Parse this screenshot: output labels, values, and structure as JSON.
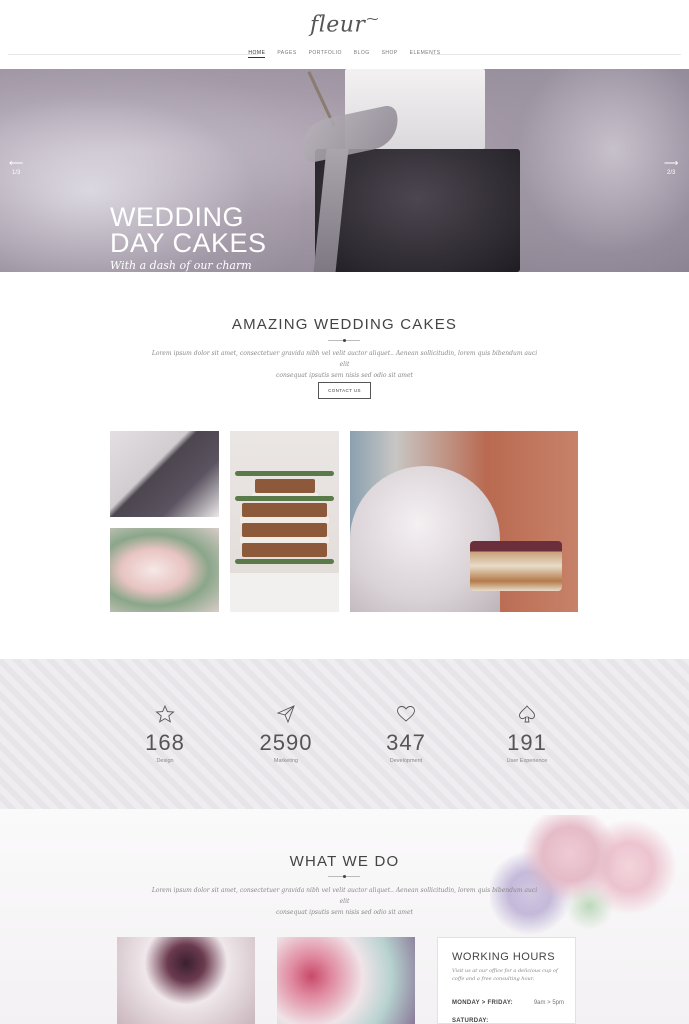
{
  "header": {
    "logo": "fleur",
    "nav": [
      "HOME",
      "PAGES",
      "PORTFOLIO",
      "BLOG",
      "SHOP",
      "ELEMENTS"
    ]
  },
  "hero": {
    "title_line1": "WEDDING",
    "title_line2": "DAY CAKES",
    "subtitle": "With a dash of our charm",
    "prev_count": "1/3",
    "next_count": "2/3"
  },
  "amazing": {
    "title": "AMAZING WEDDING CAKES",
    "text_line1": "Lorem ipsum dolor sit amet, consectetuer gravida nibh vel velit auctor aliquet.. Aenean sollicitudin, lorem quis bibendum auci elit",
    "text_line2": "consequat ipsutis sem nisis sed odio sit amet",
    "button": "CONTACT US"
  },
  "stats": [
    {
      "icon": "star-icon",
      "value": "168",
      "label": "Design"
    },
    {
      "icon": "paper-plane-icon",
      "value": "2590",
      "label": "Marketing"
    },
    {
      "icon": "heart-icon",
      "value": "347",
      "label": "Development"
    },
    {
      "icon": "spade-icon",
      "value": "191",
      "label": "User Experience"
    }
  ],
  "what_we_do": {
    "title": "WHAT WE DO",
    "text_line1": "Lorem ipsum dolor sit amet, consectetuer gravida nibh vel velit auctor aliquet.. Aenean sollicitudin, lorem quis bibendum auci elit",
    "text_line2": "consequat ipsutis sem nisis sed odio sit amet"
  },
  "working_hours": {
    "title": "WORKING HOURS",
    "text": "Visit us at our office for a delicious cup of coffe and a free consulting hour.",
    "row1_day": "MONDAY > FRIDAY:",
    "row1_time": "9am > 5pm",
    "row2_day": "SATURDAY:"
  },
  "colors": {
    "accent": "#444444",
    "hero_text": "#ffffff",
    "stats_bg": "#efedf0"
  }
}
